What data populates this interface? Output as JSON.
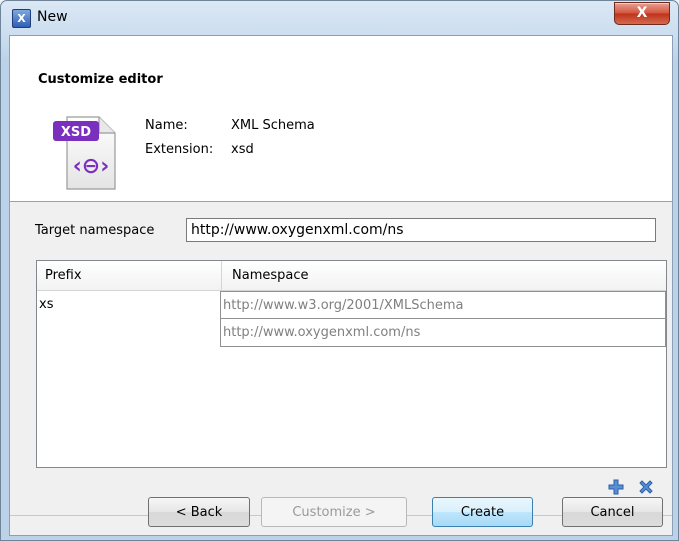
{
  "window": {
    "title": "New",
    "close_glyph": "X"
  },
  "header": {
    "title": "Customize editor",
    "icon_badge": "XSD",
    "icon_symbol": "‹⊖›",
    "name_label": "Name:",
    "name_value": "XML Schema",
    "extension_label": "Extension:",
    "extension_value": "xsd"
  },
  "target_namespace": {
    "label": "Target namespace",
    "value": "http://www.oxygenxml.com/ns"
  },
  "table": {
    "columns": [
      "Prefix",
      "Namespace"
    ],
    "rows": [
      {
        "prefix": "xs",
        "namespace": "http://www.w3.org/2001/XMLSchema"
      },
      {
        "prefix": "",
        "namespace": "http://www.oxygenxml.com/ns"
      }
    ]
  },
  "buttons": {
    "back": "< Back",
    "customize": "Customize >",
    "create": "Create",
    "cancel": "Cancel"
  },
  "colors": {
    "accent_blue": "#3c7fb1",
    "xsd_purple": "#7b2fbe",
    "disabled_text": "#9a9a9a"
  },
  "icons": [
    "app-icon",
    "close-icon",
    "xsd-file-icon",
    "add-icon",
    "remove-icon"
  ]
}
